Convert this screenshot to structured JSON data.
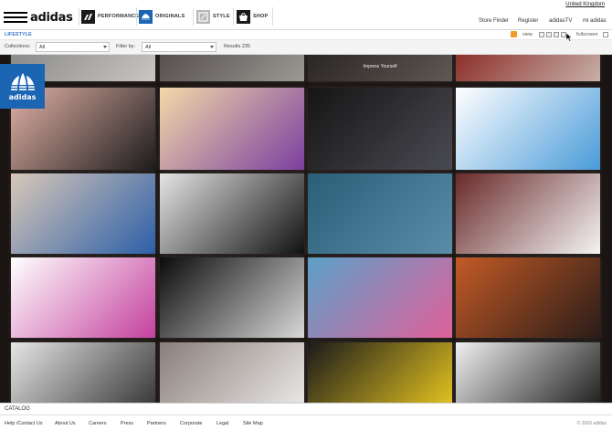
{
  "brand": {
    "name": "adidas",
    "badge_text": "adidas"
  },
  "nav": {
    "tabs": [
      {
        "label": "PERFORMANCE",
        "icon": "performance-icon"
      },
      {
        "label": "ORIGINALS",
        "icon": "trefoil-icon"
      },
      {
        "label": "STYLE",
        "icon": "style-icon"
      },
      {
        "label": "SHOP",
        "icon": "shop-icon"
      }
    ]
  },
  "topright": {
    "country": "United Kingdom",
    "links": [
      "Store Finder",
      "Register",
      "adidasTV",
      "mi adidas"
    ]
  },
  "section": {
    "title": "LIFESTYLE",
    "view_label": "view",
    "fullscreen_label": "fullscreen"
  },
  "filters": {
    "collections_label": "Collections:",
    "collections_value": "All",
    "filter_label": "Filter by:",
    "filter_value": "All",
    "results": "Results 235"
  },
  "gallery": {
    "caption": "Impress Yourself",
    "tiles": [
      {
        "name": "tile-top-1",
        "colors": [
          "#8a8a8a",
          "#c9c6c2"
        ]
      },
      {
        "name": "tile-top-2",
        "colors": [
          "#55504d",
          "#9c9894"
        ]
      },
      {
        "name": "tile-top-3",
        "colors": [
          "#2a2624",
          "#5f5854"
        ]
      },
      {
        "name": "tile-top-4",
        "colors": [
          "#8d2f2a",
          "#c7b0a8"
        ]
      },
      {
        "name": "tile-legs",
        "colors": [
          "#e2b1a6",
          "#1c1c1c"
        ]
      },
      {
        "name": "tile-illustration",
        "colors": [
          "#f2d9a8",
          "#7c3fa0"
        ]
      },
      {
        "name": "tile-two-men",
        "colors": [
          "#151515",
          "#4a4a52"
        ]
      },
      {
        "name": "tile-toys-white",
        "colors": [
          "#ffffff",
          "#4a9bd9"
        ]
      },
      {
        "name": "tile-bag-head",
        "colors": [
          "#d8c8b8",
          "#2c5fa8"
        ]
      },
      {
        "name": "tile-sneaker-bw",
        "colors": [
          "#e5e5e5",
          "#111111"
        ]
      },
      {
        "name": "tile-toys-crowd",
        "colors": [
          "#2a5f78",
          "#5a8ca8"
        ]
      },
      {
        "name": "tile-polaroids",
        "colors": [
          "#6a2a2a",
          "#f4f4f4"
        ]
      },
      {
        "name": "tile-bunny-toy",
        "colors": [
          "#ffffff",
          "#c4419e"
        ]
      },
      {
        "name": "tile-boxers",
        "colors": [
          "#0b0b0b",
          "#d8d8d8"
        ]
      },
      {
        "name": "tile-dancers",
        "colors": [
          "#5ba1c8",
          "#e0609a"
        ]
      },
      {
        "name": "tile-goggles",
        "colors": [
          "#c45a26",
          "#2a1c18"
        ]
      },
      {
        "name": "tile-bottom-1",
        "colors": [
          "#e6e6e6",
          "#3a3a3a"
        ]
      },
      {
        "name": "tile-bottom-2",
        "colors": [
          "#8a7f7a",
          "#e8e6e4"
        ]
      },
      {
        "name": "tile-bottom-3",
        "colors": [
          "#1a1a1a",
          "#e0c020"
        ]
      },
      {
        "name": "tile-bottom-4",
        "colors": [
          "#f0f0f0",
          "#222222"
        ]
      }
    ]
  },
  "catalog": {
    "label": "CATALOG"
  },
  "footer": {
    "links": [
      "Help /Contact Us",
      "About Us",
      "Careers",
      "Press",
      "Partners",
      "Corporate",
      "Legal",
      "Site Map"
    ],
    "copyright": "© 2009 adidas"
  },
  "colors": {
    "accent": "#3a78c9",
    "badge": "#1c65b3",
    "rss": "#f39a2a"
  }
}
